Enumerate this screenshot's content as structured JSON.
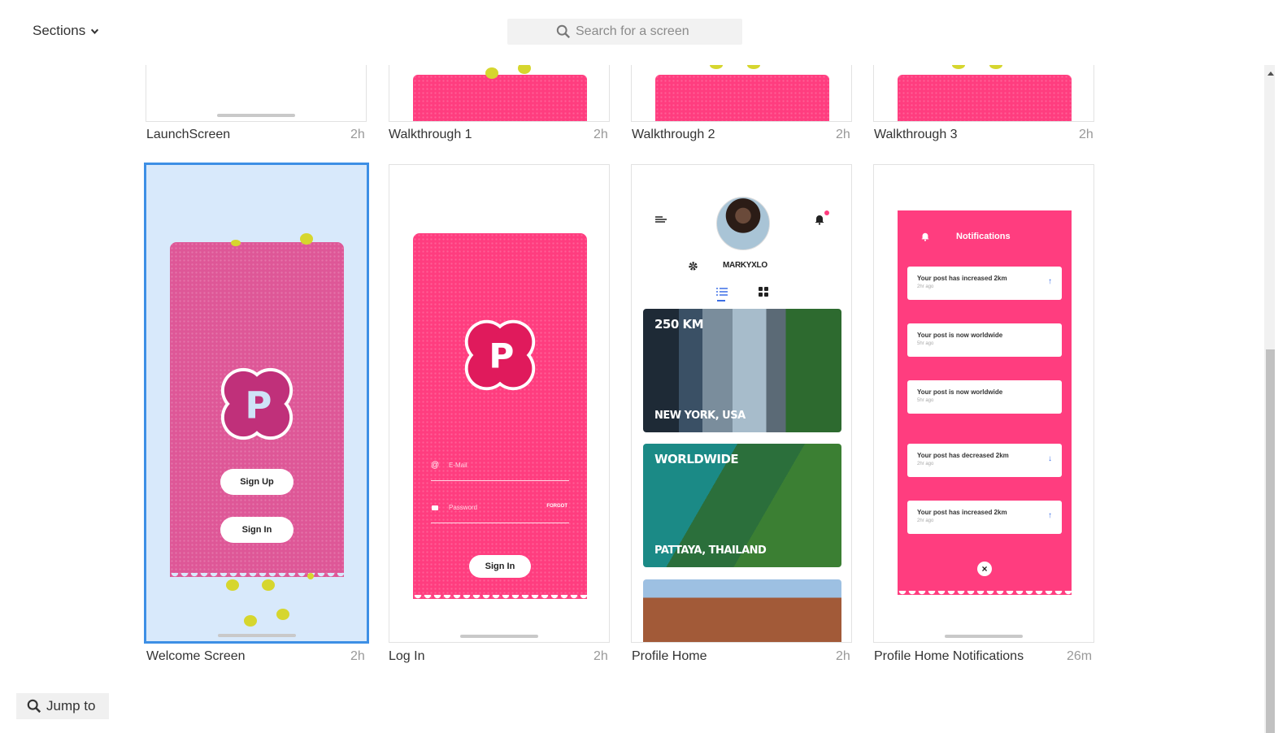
{
  "header": {
    "sections_label": "Sections",
    "search_placeholder": "Search for a screen"
  },
  "screens_row1": [
    {
      "name": "LaunchScreen",
      "time": "2h"
    },
    {
      "name": "Walkthrough 1",
      "time": "2h"
    },
    {
      "name": "Walkthrough 2",
      "time": "2h"
    },
    {
      "name": "Walkthrough 3",
      "time": "2h"
    }
  ],
  "screens_row2": [
    {
      "name": "Welcome Screen",
      "time": "2h"
    },
    {
      "name": "Log In",
      "time": "2h"
    },
    {
      "name": "Profile Home",
      "time": "2h"
    },
    {
      "name": "Profile Home Notifications",
      "time": "26m"
    }
  ],
  "welcome": {
    "signup": "Sign Up",
    "signin": "Sign In",
    "logo_letter": "P"
  },
  "login": {
    "email_placeholder": "E-Mail",
    "password_placeholder": "Password",
    "forgot": "FORGOT",
    "signin": "Sign In",
    "logo_letter": "P"
  },
  "profile": {
    "username": "MARKYXLO",
    "cards": [
      {
        "top": "250 KM",
        "bottom": "NEW YORK, USA"
      },
      {
        "top": "WORLDWIDE",
        "bottom": "PATTAYA, THAILAND"
      }
    ]
  },
  "notifications": {
    "title": "Notifications",
    "items": [
      {
        "text": "Your post has increased 2km",
        "ago": "2hr ago",
        "arrow": "↑"
      },
      {
        "text": "Your post is now worldwide",
        "ago": "5hr ago",
        "arrow": ""
      },
      {
        "text": "Your post is now worldwide",
        "ago": "5hr ago",
        "arrow": ""
      },
      {
        "text": "Your post has decreased 2km",
        "ago": "2hr ago",
        "arrow": "↓"
      },
      {
        "text": "Your post has increased 2km",
        "ago": "2hr ago",
        "arrow": "↑"
      }
    ],
    "close": "×"
  },
  "footer": {
    "jump_label": "Jump to"
  },
  "colors": {
    "accent_pink": "#ff3d7f",
    "selection_blue": "#3d8fe5"
  }
}
